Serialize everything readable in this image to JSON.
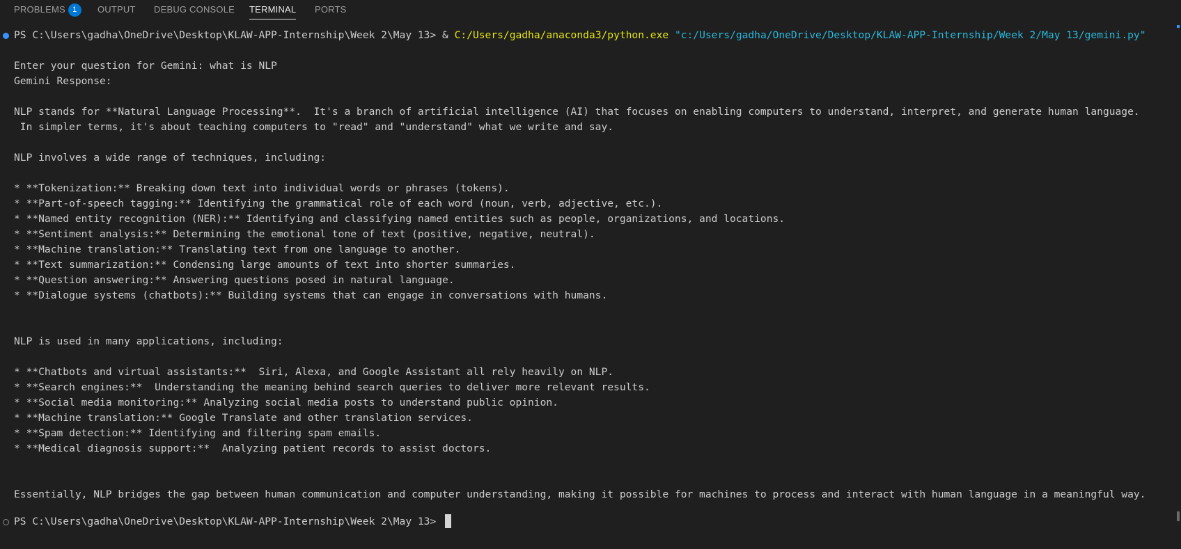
{
  "panel": {
    "tabs": [
      {
        "label": "PROBLEMS",
        "badge": "1"
      },
      {
        "label": "OUTPUT"
      },
      {
        "label": "DEBUG CONSOLE"
      },
      {
        "label": "TERMINAL"
      },
      {
        "label": "PORTS"
      }
    ],
    "active_tab": "TERMINAL"
  },
  "terminal": {
    "command": {
      "prompt": "PS C:\\Users\\gadha\\OneDrive\\Desktop\\KLAW-APP-Internship\\Week 2\\May 13> ",
      "operator": "& ",
      "exe": "C:/Users/gadha/anaconda3/python.exe",
      "arg": "\"c:/Users/gadha/OneDrive/Desktop/KLAW-APP-Internship/Week 2/May 13/gemini.py\""
    },
    "output": [
      "Enter your question for Gemini: what is NLP",
      "Gemini Response:",
      "",
      "NLP stands for **Natural Language Processing**.  It's a branch of artificial intelligence (AI) that focuses on enabling computers to understand, interpret, and generate human language.",
      " In simpler terms, it's about teaching computers to \"read\" and \"understand\" what we write and say.",
      "",
      "NLP involves a wide range of techniques, including:",
      "",
      "* **Tokenization:** Breaking down text into individual words or phrases (tokens).",
      "* **Part-of-speech tagging:** Identifying the grammatical role of each word (noun, verb, adjective, etc.).",
      "* **Named entity recognition (NER):** Identifying and classifying named entities such as people, organizations, and locations.",
      "* **Sentiment analysis:** Determining the emotional tone of text (positive, negative, neutral).",
      "* **Machine translation:** Translating text from one language to another.",
      "* **Text summarization:** Condensing large amounts of text into shorter summaries.",
      "* **Question answering:** Answering questions posed in natural language.",
      "* **Dialogue systems (chatbots):** Building systems that can engage in conversations with humans.",
      "",
      "",
      "NLP is used in many applications, including:",
      "",
      "* **Chatbots and virtual assistants:**  Siri, Alexa, and Google Assistant all rely heavily on NLP.",
      "* **Search engines:**  Understanding the meaning behind search queries to deliver more relevant results.",
      "* **Social media monitoring:** Analyzing social media posts to understand public opinion.",
      "* **Machine translation:** Google Translate and other translation services.",
      "* **Spam detection:** Identifying and filtering spam emails.",
      "* **Medical diagnosis support:**  Analyzing patient records to assist doctors.",
      "",
      "",
      "Essentially, NLP bridges the gap between human communication and computer understanding, making it possible for machines to process and interact with human language in a meaningful way."
    ],
    "final_prompt": "PS C:\\Users\\gadha\\OneDrive\\Desktop\\KLAW-APP-Internship\\Week 2\\May 13> "
  },
  "colors": {
    "background": "#1f1f1f",
    "text": "#cccccc",
    "exe": "#e5e510",
    "arg": "#29b8db",
    "badge": "#0078d4",
    "success_dot": "#3794ff"
  },
  "icons": {
    "command_status": "command-success-dot-icon",
    "prompt_status": "command-idle-dot-icon"
  }
}
